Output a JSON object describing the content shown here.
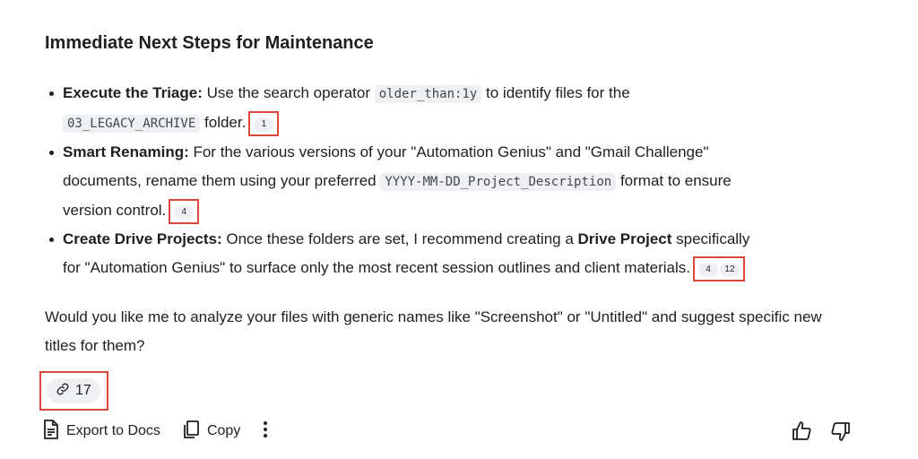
{
  "heading": "Immediate Next Steps for Maintenance",
  "bullets": [
    {
      "title": "Execute the Triage:",
      "text1": " Use the search operator ",
      "code1": "older_than:1y",
      "text2": " to identify files for the",
      "code2": "03_LEGACY_ARCHIVE",
      "text3": " folder.",
      "citations": [
        "1"
      ]
    },
    {
      "title": "Smart Renaming:",
      "text1": " For the various versions of your \"Automation Genius\" and \"Gmail Challenge\"",
      "text2": "documents, rename them using your preferred ",
      "code1": "YYYY-MM-DD_Project_Description",
      "text3": " format to ensure",
      "text4": "version control.",
      "citations": [
        "4"
      ]
    },
    {
      "title": "Create Drive Projects:",
      "text1": " Once these folders are set, I recommend creating a ",
      "bold2": "Drive Project",
      "text2": " specifically",
      "text3": "for \"Automation Genius\" to surface only the most recent session outlines and client materials.",
      "citations": [
        "4",
        "12"
      ]
    }
  ],
  "question": "Would you like me to analyze your files with generic names like \"Screenshot\" or \"Untitled\" and suggest specific new titles for them?",
  "sources": {
    "icon": "link-icon",
    "count": "17"
  },
  "toolbar": {
    "export_label": "Export to Docs",
    "copy_label": "Copy",
    "export_icon": "document-icon",
    "copy_icon": "copy-icon",
    "more_icon": "more-vertical-icon"
  },
  "rating": {
    "up_icon": "thumbs-up-icon",
    "down_icon": "thumbs-down-icon"
  },
  "colors": {
    "highlight_box": "#d9483b",
    "chip_background": "#eef0f4",
    "text": "#1f1f1f"
  }
}
